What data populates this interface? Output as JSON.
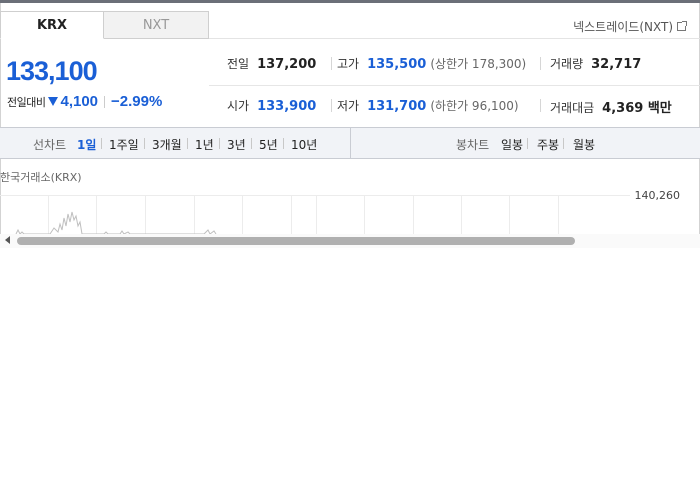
{
  "tabs": {
    "krx": "KRX",
    "nxt": "NXT"
  },
  "nxt_link": "넥스트레이드(NXT)",
  "price": {
    "current": "133,100",
    "change_label": "전일대비",
    "change": "4,100",
    "change_pct": "−2.99%",
    "direction_icon": "down-triangle-icon"
  },
  "info": {
    "prev_close": {
      "label": "전일",
      "value": "137,200"
    },
    "high": {
      "label": "고가",
      "value": "135,500",
      "sub": "(상한가 178,300)"
    },
    "volume": {
      "label": "거래량",
      "value": "32,717"
    },
    "open": {
      "label": "시가",
      "value": "133,900"
    },
    "low": {
      "label": "저가",
      "value": "131,700",
      "sub": "(하한가 96,100)"
    },
    "trade_value": {
      "label": "거래대금",
      "value": "4,369 백만"
    }
  },
  "periods": {
    "line_label": "선차트",
    "line": [
      "1일",
      "1주일",
      "3개월",
      "1년",
      "3년",
      "5년",
      "10년"
    ],
    "active": "1일",
    "candle_label": "봉차트",
    "candle": [
      "일봉",
      "주봉",
      "월봉"
    ]
  },
  "chart": {
    "title": "한국거래소(KRX)",
    "axis_top": "140,260"
  },
  "colors": {
    "down": "#1a5fd6",
    "accent_bar": "#6b6f78"
  }
}
